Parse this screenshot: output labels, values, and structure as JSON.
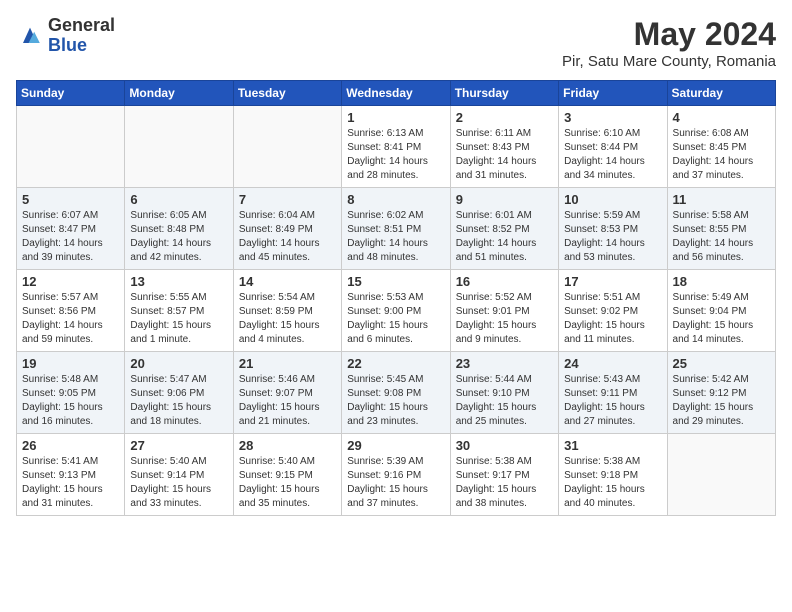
{
  "header": {
    "logo_general": "General",
    "logo_blue": "Blue",
    "month_title": "May 2024",
    "location": "Pir, Satu Mare County, Romania"
  },
  "days_of_week": [
    "Sunday",
    "Monday",
    "Tuesday",
    "Wednesday",
    "Thursday",
    "Friday",
    "Saturday"
  ],
  "weeks": [
    [
      {
        "day": "",
        "info": ""
      },
      {
        "day": "",
        "info": ""
      },
      {
        "day": "",
        "info": ""
      },
      {
        "day": "1",
        "info": "Sunrise: 6:13 AM\nSunset: 8:41 PM\nDaylight: 14 hours\nand 28 minutes."
      },
      {
        "day": "2",
        "info": "Sunrise: 6:11 AM\nSunset: 8:43 PM\nDaylight: 14 hours\nand 31 minutes."
      },
      {
        "day": "3",
        "info": "Sunrise: 6:10 AM\nSunset: 8:44 PM\nDaylight: 14 hours\nand 34 minutes."
      },
      {
        "day": "4",
        "info": "Sunrise: 6:08 AM\nSunset: 8:45 PM\nDaylight: 14 hours\nand 37 minutes."
      }
    ],
    [
      {
        "day": "5",
        "info": "Sunrise: 6:07 AM\nSunset: 8:47 PM\nDaylight: 14 hours\nand 39 minutes."
      },
      {
        "day": "6",
        "info": "Sunrise: 6:05 AM\nSunset: 8:48 PM\nDaylight: 14 hours\nand 42 minutes."
      },
      {
        "day": "7",
        "info": "Sunrise: 6:04 AM\nSunset: 8:49 PM\nDaylight: 14 hours\nand 45 minutes."
      },
      {
        "day": "8",
        "info": "Sunrise: 6:02 AM\nSunset: 8:51 PM\nDaylight: 14 hours\nand 48 minutes."
      },
      {
        "day": "9",
        "info": "Sunrise: 6:01 AM\nSunset: 8:52 PM\nDaylight: 14 hours\nand 51 minutes."
      },
      {
        "day": "10",
        "info": "Sunrise: 5:59 AM\nSunset: 8:53 PM\nDaylight: 14 hours\nand 53 minutes."
      },
      {
        "day": "11",
        "info": "Sunrise: 5:58 AM\nSunset: 8:55 PM\nDaylight: 14 hours\nand 56 minutes."
      }
    ],
    [
      {
        "day": "12",
        "info": "Sunrise: 5:57 AM\nSunset: 8:56 PM\nDaylight: 14 hours\nand 59 minutes."
      },
      {
        "day": "13",
        "info": "Sunrise: 5:55 AM\nSunset: 8:57 PM\nDaylight: 15 hours\nand 1 minute."
      },
      {
        "day": "14",
        "info": "Sunrise: 5:54 AM\nSunset: 8:59 PM\nDaylight: 15 hours\nand 4 minutes."
      },
      {
        "day": "15",
        "info": "Sunrise: 5:53 AM\nSunset: 9:00 PM\nDaylight: 15 hours\nand 6 minutes."
      },
      {
        "day": "16",
        "info": "Sunrise: 5:52 AM\nSunset: 9:01 PM\nDaylight: 15 hours\nand 9 minutes."
      },
      {
        "day": "17",
        "info": "Sunrise: 5:51 AM\nSunset: 9:02 PM\nDaylight: 15 hours\nand 11 minutes."
      },
      {
        "day": "18",
        "info": "Sunrise: 5:49 AM\nSunset: 9:04 PM\nDaylight: 15 hours\nand 14 minutes."
      }
    ],
    [
      {
        "day": "19",
        "info": "Sunrise: 5:48 AM\nSunset: 9:05 PM\nDaylight: 15 hours\nand 16 minutes."
      },
      {
        "day": "20",
        "info": "Sunrise: 5:47 AM\nSunset: 9:06 PM\nDaylight: 15 hours\nand 18 minutes."
      },
      {
        "day": "21",
        "info": "Sunrise: 5:46 AM\nSunset: 9:07 PM\nDaylight: 15 hours\nand 21 minutes."
      },
      {
        "day": "22",
        "info": "Sunrise: 5:45 AM\nSunset: 9:08 PM\nDaylight: 15 hours\nand 23 minutes."
      },
      {
        "day": "23",
        "info": "Sunrise: 5:44 AM\nSunset: 9:10 PM\nDaylight: 15 hours\nand 25 minutes."
      },
      {
        "day": "24",
        "info": "Sunrise: 5:43 AM\nSunset: 9:11 PM\nDaylight: 15 hours\nand 27 minutes."
      },
      {
        "day": "25",
        "info": "Sunrise: 5:42 AM\nSunset: 9:12 PM\nDaylight: 15 hours\nand 29 minutes."
      }
    ],
    [
      {
        "day": "26",
        "info": "Sunrise: 5:41 AM\nSunset: 9:13 PM\nDaylight: 15 hours\nand 31 minutes."
      },
      {
        "day": "27",
        "info": "Sunrise: 5:40 AM\nSunset: 9:14 PM\nDaylight: 15 hours\nand 33 minutes."
      },
      {
        "day": "28",
        "info": "Sunrise: 5:40 AM\nSunset: 9:15 PM\nDaylight: 15 hours\nand 35 minutes."
      },
      {
        "day": "29",
        "info": "Sunrise: 5:39 AM\nSunset: 9:16 PM\nDaylight: 15 hours\nand 37 minutes."
      },
      {
        "day": "30",
        "info": "Sunrise: 5:38 AM\nSunset: 9:17 PM\nDaylight: 15 hours\nand 38 minutes."
      },
      {
        "day": "31",
        "info": "Sunrise: 5:38 AM\nSunset: 9:18 PM\nDaylight: 15 hours\nand 40 minutes."
      },
      {
        "day": "",
        "info": ""
      }
    ]
  ]
}
